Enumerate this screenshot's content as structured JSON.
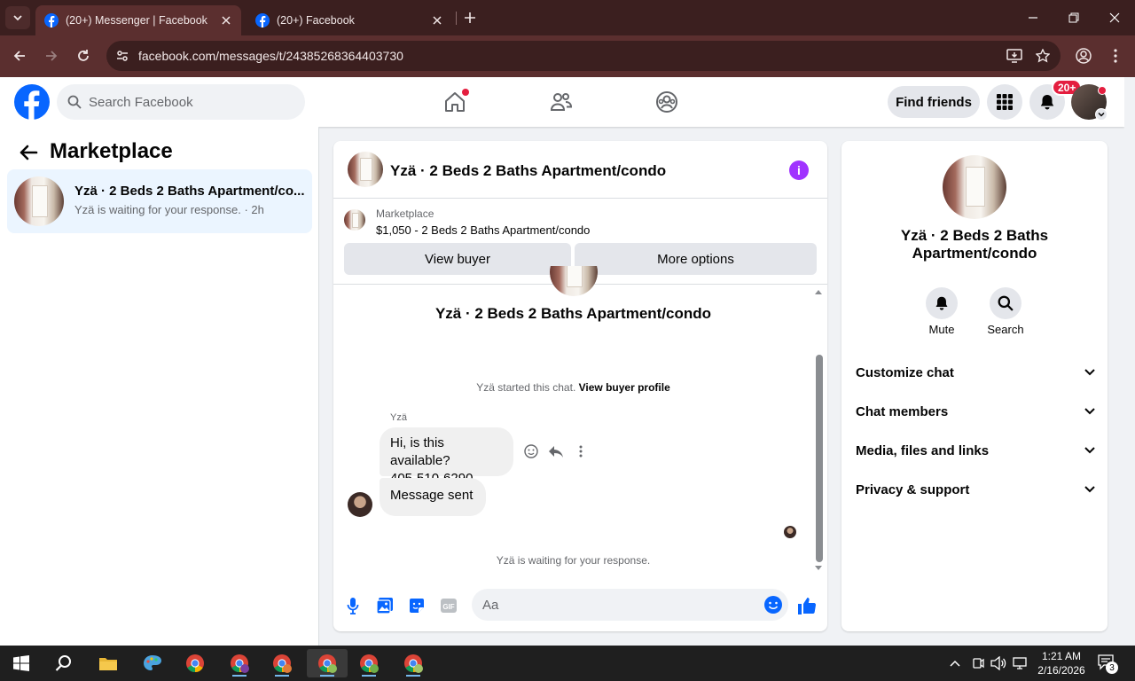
{
  "browser": {
    "tabs": [
      {
        "title": "(20+) Messenger | Facebook",
        "active": true
      },
      {
        "title": "(20+) Facebook",
        "active": false
      }
    ],
    "url": "facebook.com/messages/t/24385268364403730"
  },
  "header": {
    "search_placeholder": "Search Facebook",
    "find_friends_label": "Find friends",
    "notification_badge": "20+",
    "brand_color": "#0866ff"
  },
  "sidebar": {
    "title": "Marketplace",
    "conversations": [
      {
        "title": "Yzä · 2 Beds 2 Baths Apartment/co...",
        "subtitle": "Yzä is waiting for your response. · 2h"
      }
    ]
  },
  "chat": {
    "title": "Yzä · 2 Beds 2 Baths Apartment/condo",
    "marketplace_label": "Marketplace",
    "listing": "$1,050 - 2 Beds 2 Baths Apartment/condo",
    "view_buyer_label": "View buyer",
    "more_options_label": "More options",
    "hero_name": "Yzä · 2 Beds 2 Baths Apartment/condo",
    "started_text": "Yzä started this chat.",
    "view_profile_label": "View buyer profile",
    "sender_name": "Yzä",
    "messages": [
      {
        "line1": "Hi, is this available?",
        "line2": "405-510-6290"
      },
      {
        "line1": "Message sent"
      }
    ],
    "waiting_text": "Yzä is waiting for your response.",
    "composer_placeholder": "Aa"
  },
  "details": {
    "name": "Yzä · 2 Beds 2 Baths Apartment/condo",
    "actions": [
      {
        "label": "Mute",
        "icon": "bell-icon"
      },
      {
        "label": "Search",
        "icon": "search-icon"
      }
    ],
    "sections": [
      "Customize chat",
      "Chat members",
      "Media, files and links",
      "Privacy & support"
    ]
  },
  "taskbar": {
    "time": "1:21 AM",
    "date": "2/16/2026",
    "notifications": "3"
  }
}
